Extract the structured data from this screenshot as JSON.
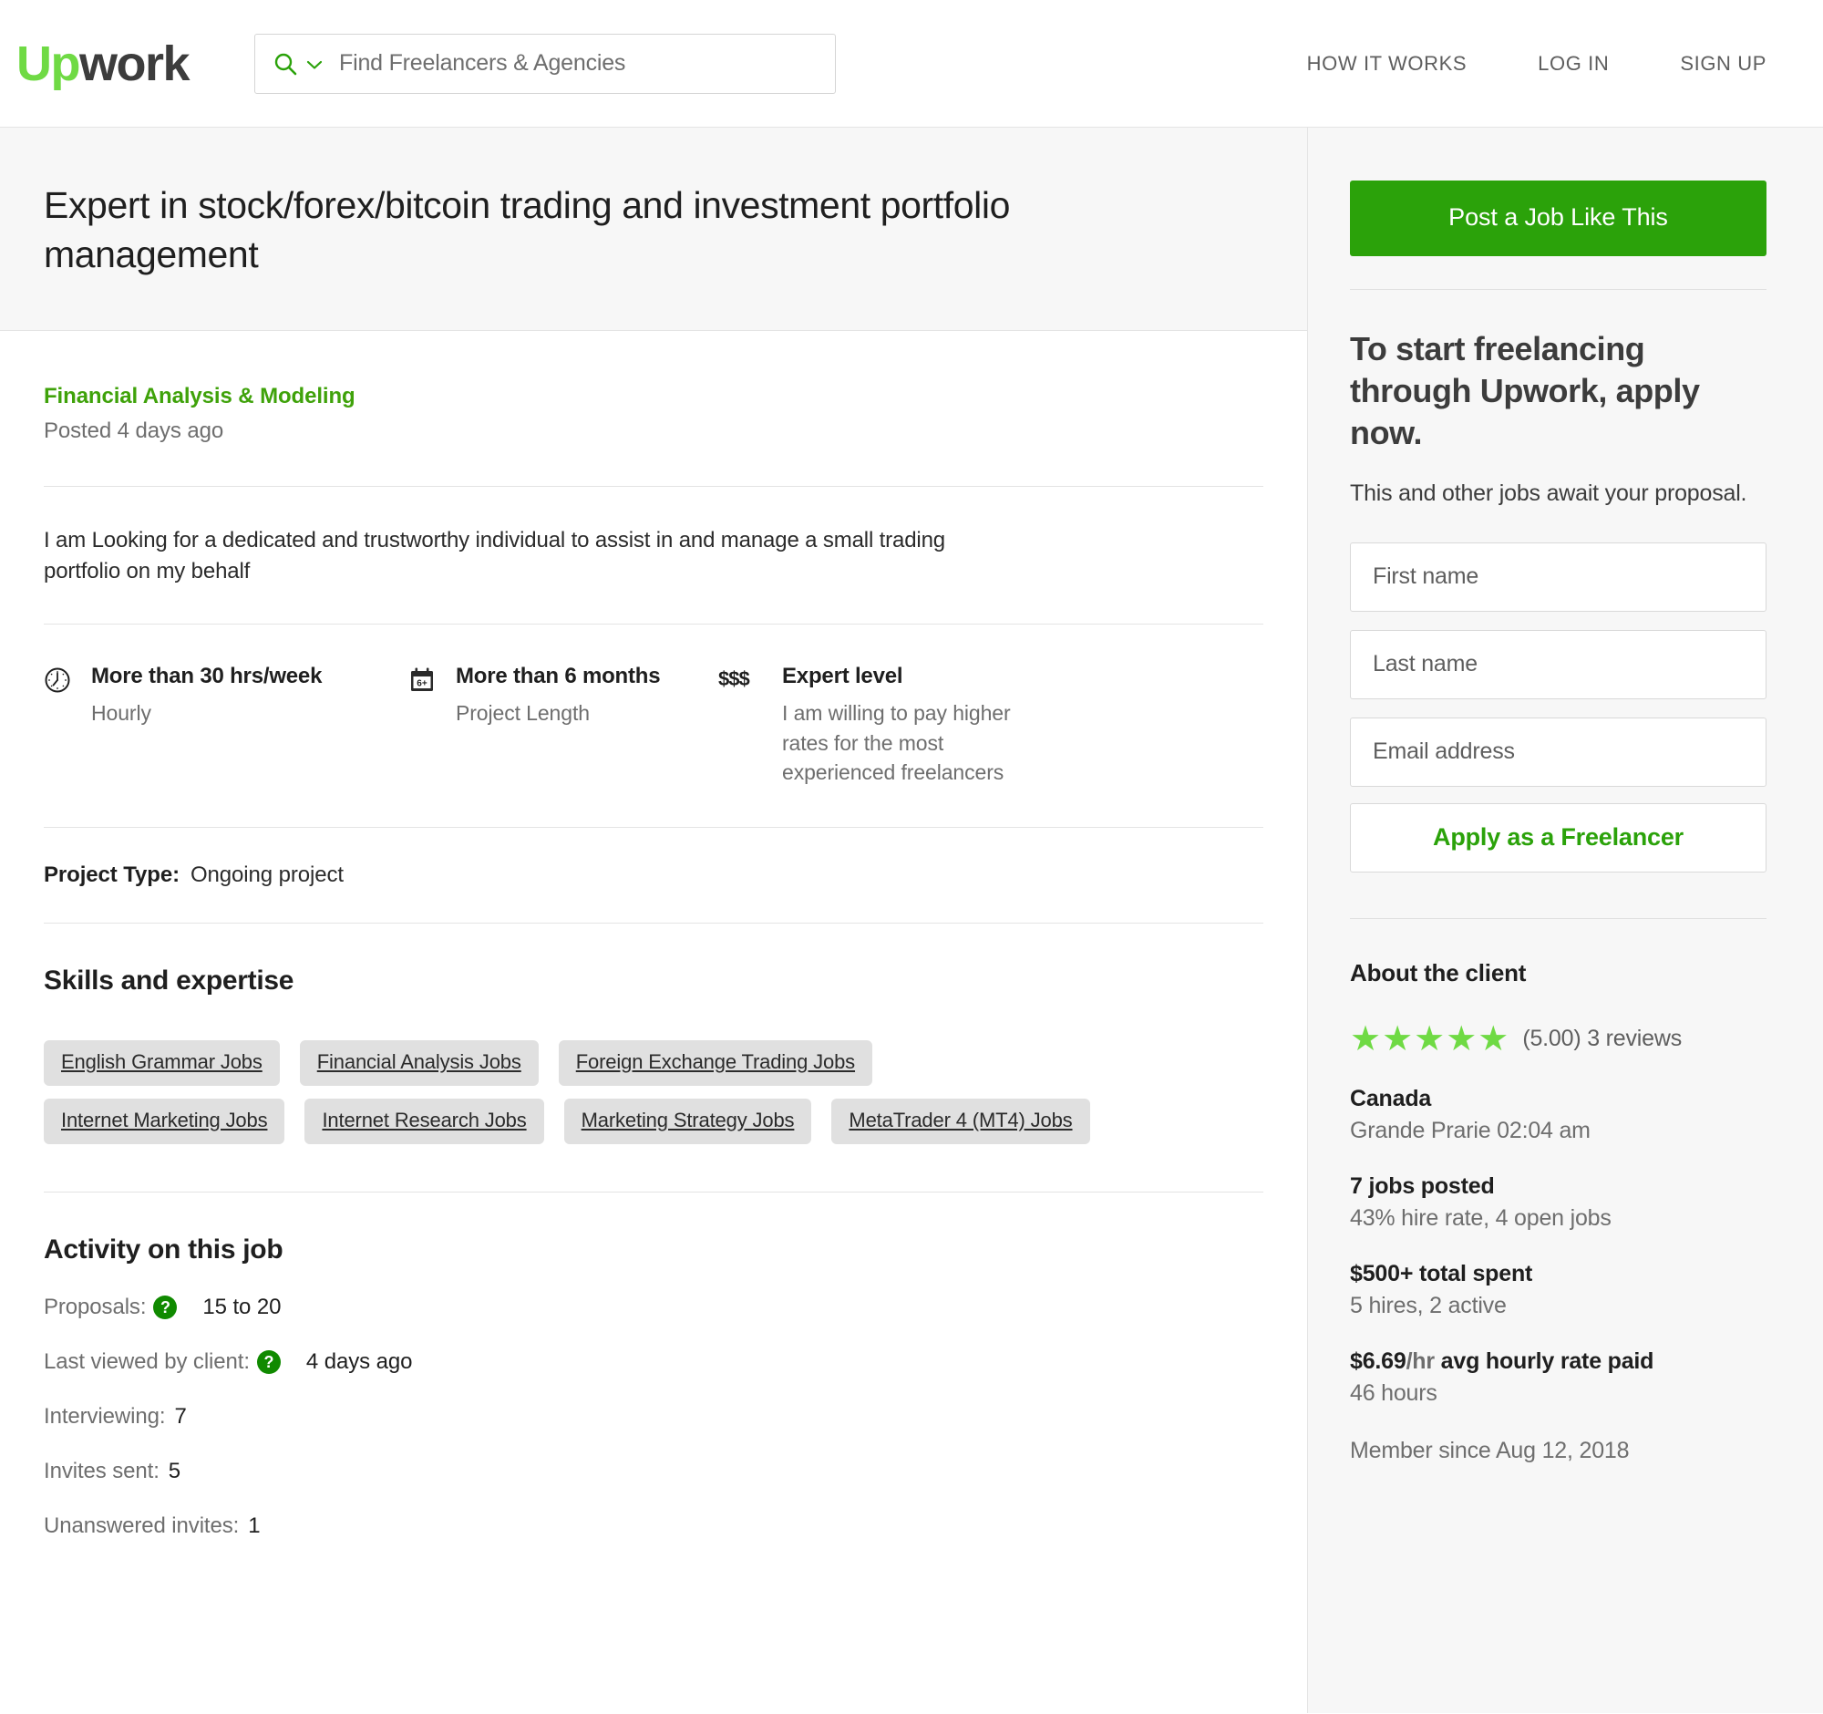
{
  "header": {
    "logo_up": "Up",
    "logo_work": "work",
    "search_placeholder": "Find Freelancers & Agencies",
    "search_value": "",
    "search_icon": "search-icon",
    "dropdown_icon": "chevron-down-icon",
    "nav": [
      {
        "label": "HOW IT WORKS"
      },
      {
        "label": "LOG IN"
      },
      {
        "label": "SIGN UP"
      }
    ]
  },
  "job": {
    "title": "Expert in stock/forex/bitcoin trading and investment portfolio management",
    "category": "Financial Analysis & Modeling",
    "posted": "Posted 4 days ago",
    "description": "I am Looking for a dedicated and trustworthy individual to assist in and manage a small trading portfolio on my behalf",
    "details": [
      {
        "icon": "clock-icon",
        "title": "More than 30 hrs/week",
        "sub": "Hourly"
      },
      {
        "icon": "calendar-icon",
        "icon_text": "6+",
        "title": "More than 6 months",
        "sub": "Project Length"
      },
      {
        "icon": "dollar-signs-icon",
        "icon_text": "$$$",
        "title": "Expert level",
        "sub": "I am willing to pay higher rates for the most experienced freelancers"
      }
    ],
    "project_type_label": "Project Type:",
    "project_type_value": "Ongoing project",
    "skills_heading": "Skills and expertise",
    "skills": [
      "English Grammar Jobs",
      "Financial Analysis Jobs",
      "Foreign Exchange Trading Jobs",
      "Internet Marketing Jobs",
      "Internet Research Jobs",
      "Marketing Strategy Jobs",
      "MetaTrader 4 (MT4) Jobs"
    ],
    "activity_heading": "Activity on this job",
    "activity": [
      {
        "label": "Proposals:",
        "help": true,
        "value": "15 to 20"
      },
      {
        "label": "Last viewed by client:",
        "help": true,
        "value": "4 days ago"
      },
      {
        "label": "Interviewing:",
        "help": false,
        "value": "7"
      },
      {
        "label": "Invites sent:",
        "help": false,
        "value": "5"
      },
      {
        "label": "Unanswered invites:",
        "help": false,
        "value": "1"
      }
    ]
  },
  "sidebar": {
    "post_job_button": "Post a Job Like This",
    "heading": "To start freelancing through Upwork, apply now.",
    "subtext": "This and other jobs await your proposal.",
    "first_name_placeholder": "First name",
    "first_name_value": "",
    "last_name_placeholder": "Last name",
    "last_name_value": "",
    "email_placeholder": "Email address",
    "email_value": "",
    "apply_button": "Apply as a Freelancer",
    "client": {
      "heading": "About the client",
      "stars": "★★★★★",
      "star_count": 5,
      "rating_text": "(5.00) 3 reviews",
      "country": "Canada",
      "location_time": "Grande Prarie 02:04 am",
      "jobs_posted": "7 jobs posted",
      "hire_rate": "43% hire rate, 4 open jobs",
      "total_spent": "$500+ total spent",
      "hires": "5 hires, 2 active",
      "avg_rate_amount": "$6.69",
      "avg_rate_unit": "/hr",
      "avg_rate_label": " avg hourly rate paid",
      "hours": "46 hours",
      "member_since": "Member since Aug 12, 2018"
    }
  },
  "colors": {
    "brand_green": "#6fda44",
    "accent_green": "#2ba20a",
    "link_green": "#3fa20a",
    "help_green": "#108a00",
    "text_dark": "#1f1f1f",
    "text_muted": "#6e6e6e",
    "tag_bg": "#e0e0e0",
    "sidebar_bg": "#f7f7f7"
  }
}
